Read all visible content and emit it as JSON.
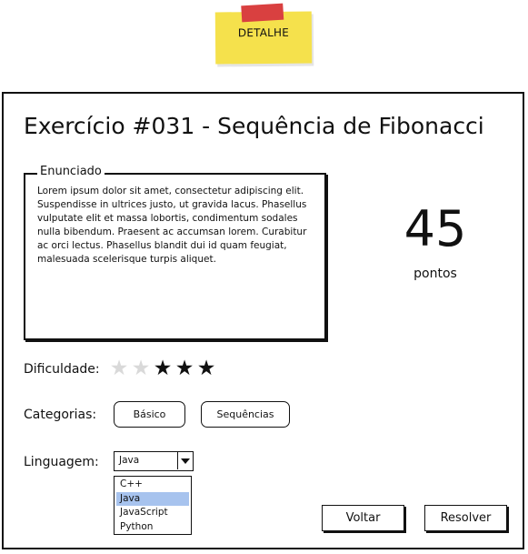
{
  "sticky_note": {
    "label": "DETALHE"
  },
  "exercise": {
    "title": "Exercício #031 - Sequência de Fibonacci",
    "statement_legend": "Enunciado",
    "statement": "Lorem ipsum dolor sit amet, consectetur adipiscing elit. Suspendisse in ultrices justo, ut gravida lacus. Phasellus vulputate elit et massa lobortis, condimentum sodales nulla bibendum. Praesent ac accumsan lorem. Curabitur ac orci lectus. Phasellus blandit dui id quam feugiat, malesuada scelerisque turpis aliquet.",
    "score": "45",
    "score_unit": "pontos"
  },
  "difficulty": {
    "label": "Dificuldade:",
    "rating": 3,
    "max": 5,
    "on_color": "#111111",
    "off_color": "#d9d9d9"
  },
  "categories": {
    "label": "Categorias:",
    "items": [
      "Básico",
      "Sequências"
    ]
  },
  "language": {
    "label": "Linguagem:",
    "selected": "Java",
    "options": [
      "C++",
      "Java",
      "JavaScript",
      "Python"
    ],
    "highlight_color": "#a7c3ee"
  },
  "actions": {
    "back_label": "Voltar",
    "solve_label": "Resolver"
  }
}
